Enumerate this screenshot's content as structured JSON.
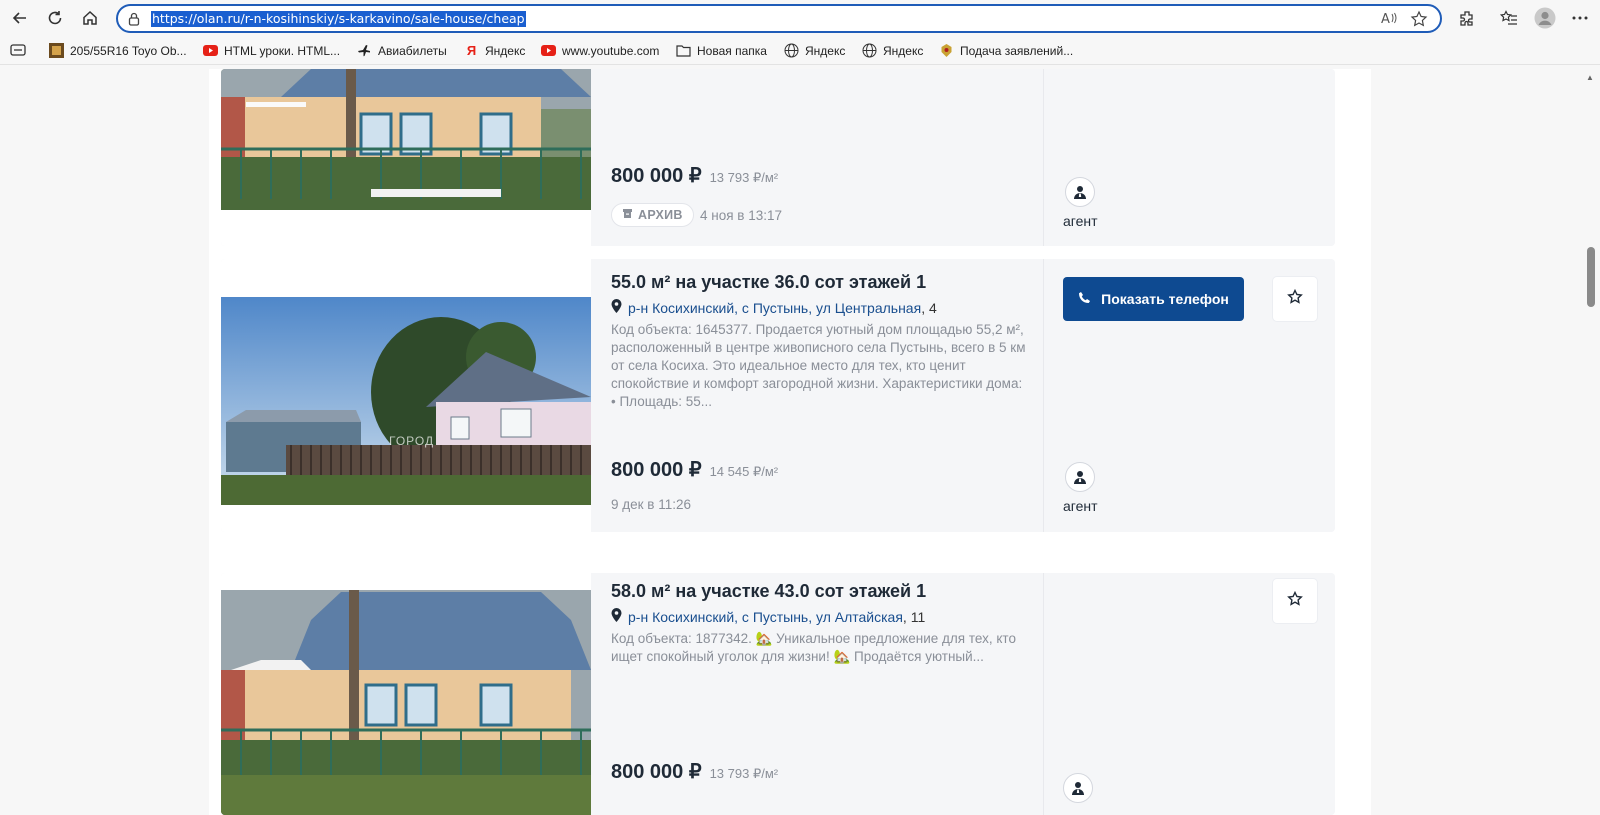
{
  "browser": {
    "url": "https://olan.ru/r-n-kosihinskiy/s-karkavino/sale-house/cheap",
    "bookmarks": [
      {
        "label": "205/55R16 Toyo Ob...",
        "icon": "tire-icon"
      },
      {
        "label": "HTML уроки. HTML...",
        "icon": "youtube-icon"
      },
      {
        "label": "Авиабилеты",
        "icon": "plane-icon"
      },
      {
        "label": "Яндекс",
        "icon": "yandex-icon"
      },
      {
        "label": "www.youtube.com",
        "icon": "youtube-icon"
      },
      {
        "label": "Новая папка",
        "icon": "folder-icon"
      },
      {
        "label": "Яндекс",
        "icon": "globe-icon"
      },
      {
        "label": "Яндекс",
        "icon": "globe-icon"
      },
      {
        "label": "Подача заявлений...",
        "icon": "emblem-icon"
      }
    ]
  },
  "listings": [
    {
      "price": "800 000 ₽",
      "price_per_m2": "13 793 ₽/м²",
      "archive_label": "АРХИВ",
      "date": "4 ноя в 13:17",
      "agent_label": "агент"
    },
    {
      "title": "55.0 м² на участке 36.0 сот этажей 1",
      "address_link": "р-н Косихинский, с Пустынь, ул Центральная",
      "address_house": ", 4",
      "description": "Код объекта: 1645377. Продается уютный дом площадью 55,2 м², расположенный в центре живописного села Пустынь, всего в 5 км от села Косиха. Это идеальное место для тех, кто ценит спокойствие и комфорт загородной жизни. Характеристики дома: • Площадь: 55...",
      "price": "800 000 ₽",
      "price_per_m2": "14 545 ₽/м²",
      "date": "9 дек в 11:26",
      "phone_button": "Показать телефон",
      "agent_label": "агент"
    },
    {
      "title": "58.0 м² на участке 43.0 сот этажей 1",
      "address_link": "р-н Косихинский, с Пустынь, ул Алтайская",
      "address_house": ", 11",
      "description": "Код объекта: 1877342. 🏡 Уникальное предложение для тех, кто ищет спокойный уголок для жизни! 🏡 Продаётся уютный...",
      "price": "800 000 ₽",
      "price_per_m2": "13 793 ₽/м²"
    }
  ],
  "colors": {
    "accent": "#0e4a91",
    "link": "#1a4f8f",
    "url_highlight": "#1a5fd0"
  }
}
